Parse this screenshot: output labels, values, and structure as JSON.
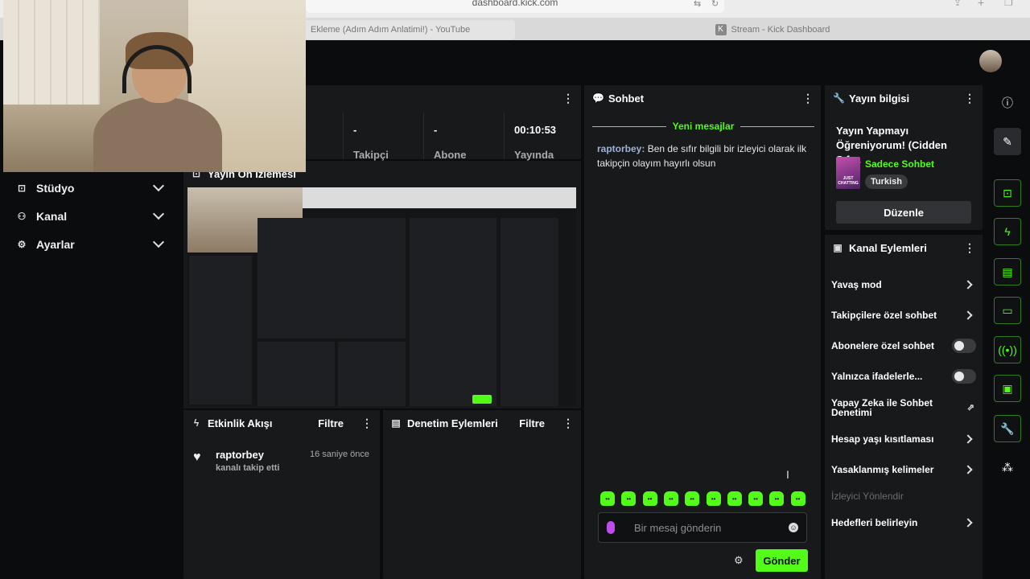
{
  "browser": {
    "url": "dashboard.kick.com",
    "tabs": [
      {
        "label": "Ekleme (Adım Adım Anlatimi!) - YouTube"
      },
      {
        "label": "Stream - Kick Dashboard"
      }
    ]
  },
  "nav": {
    "items": [
      {
        "label": "Stüdyo",
        "icon": "studio-icon"
      },
      {
        "label": "Kanal",
        "icon": "channel-icon"
      },
      {
        "label": "Ayarlar",
        "icon": "settings-icon"
      }
    ]
  },
  "stats": {
    "items": [
      {
        "value": "-",
        "label": "Takipçi"
      },
      {
        "value": "-",
        "label": "Abone"
      },
      {
        "value": "00:10:53",
        "label": "Yayında"
      }
    ]
  },
  "preview": {
    "title": "Yayın Ön İzlemesi"
  },
  "activity": {
    "title": "Etkinlik Akışı",
    "filter_label": "Filtre",
    "events": [
      {
        "user": "raptorbey",
        "time": "16 saniye önce",
        "description": "kanalı takip etti",
        "icon": "heart-icon"
      }
    ]
  },
  "moderation": {
    "title": "Denetim Eylemleri",
    "filter_label": "Filtre"
  },
  "chat": {
    "title": "Sohbet",
    "new_messages_label": "Yeni mesajlar",
    "messages": [
      {
        "user": "raptorbey",
        "text": "Ben de sıfır bilgili bir izleyici olarak ilk takipçin olayım hayırlı olsun"
      }
    ],
    "input_placeholder": "Bir mesaj gönderin",
    "send_label": "Gönder",
    "emote_count": 10
  },
  "stream_info": {
    "title": "Yayın bilgisi",
    "stream_title": "Yayın Yapmayı Öğreniyorum! (Cidden Sıfı...",
    "category": "Sadece Sohbet",
    "category_thumb_text": "JUST CHATTING",
    "language": "Turkish",
    "edit_label": "Düzenle"
  },
  "channel_actions": {
    "title": "Kanal Eylemleri",
    "items": [
      {
        "label": "Yavaş mod",
        "control": "chevron"
      },
      {
        "label": "Takipçilere özel sohbet",
        "control": "chevron"
      },
      {
        "label": "Abonelere özel sohbet",
        "control": "toggle",
        "on": false
      },
      {
        "label": "Yalnızca ifadelerle...",
        "control": "toggle",
        "on": false
      },
      {
        "label": "Yapay Zeka ile Sohbet Denetimi",
        "control": "external"
      },
      {
        "label": "Hesap yaşı kısıtlaması",
        "control": "chevron"
      },
      {
        "label": "Yasaklanmış kelimeler",
        "control": "chevron"
      },
      {
        "label": "İzleyici Yönlendir",
        "control": "none",
        "disabled": true
      },
      {
        "label": "Hedefleri belirleyin",
        "control": "chevron"
      }
    ]
  },
  "rail": {
    "buttons": [
      "info-icon",
      "pencil-icon",
      "camera-icon",
      "lightning-icon",
      "document-icon",
      "chat-icon",
      "broadcast-icon",
      "layout-icon",
      "wrench-icon",
      "more-icon"
    ]
  },
  "colors": {
    "accent": "#53fc18",
    "panel": "#18191b",
    "background": "#0b0c0d"
  }
}
